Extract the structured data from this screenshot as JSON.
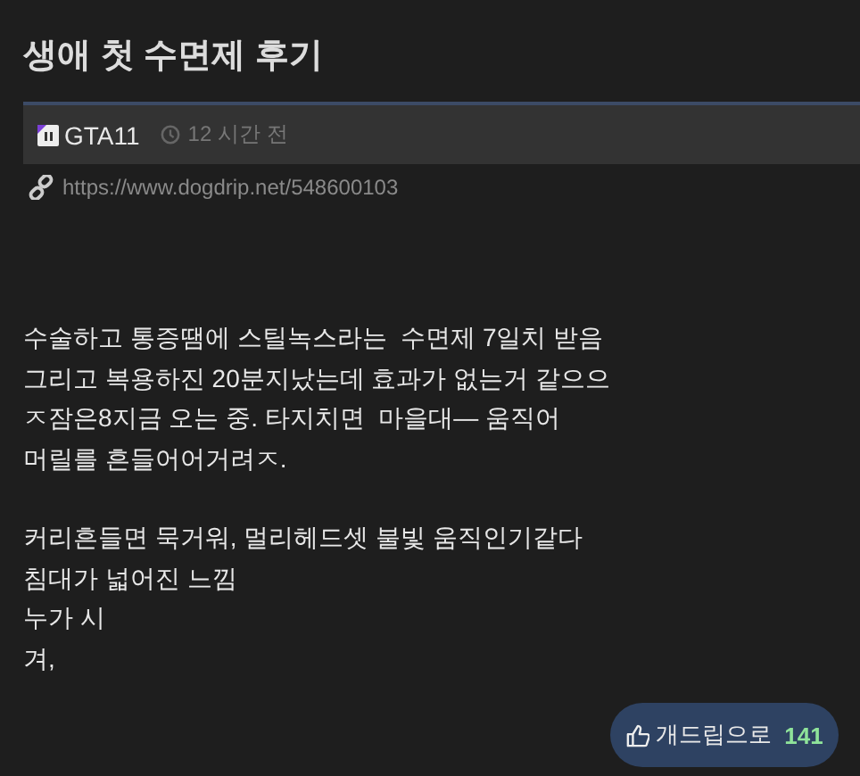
{
  "post": {
    "title": "생애 첫 수면제 후기",
    "author": "GTA11",
    "time": "12 시간 전",
    "url": "https://www.dogdrip.net/548600103",
    "paragraphs": [
      [
        "수술하고 통증땜에 스틸녹스라는  수면제 7일치 받음",
        "그리고 복용하진 20분지났는데 효과가 없는거 같으으",
        "ㅈ잠은8지금 오는 중. 타지치면  마을대— 움직어",
        "머릴를 흔들어어거려ㅈ."
      ],
      [
        "커리흔들면 묵거워, 멀리헤드셋 불빛 움직인기같다",
        "침대가 넓어진 느낌",
        "누가 시",
        "겨,"
      ]
    ],
    "vote": {
      "label": "개드립으로",
      "count": "141"
    }
  }
}
